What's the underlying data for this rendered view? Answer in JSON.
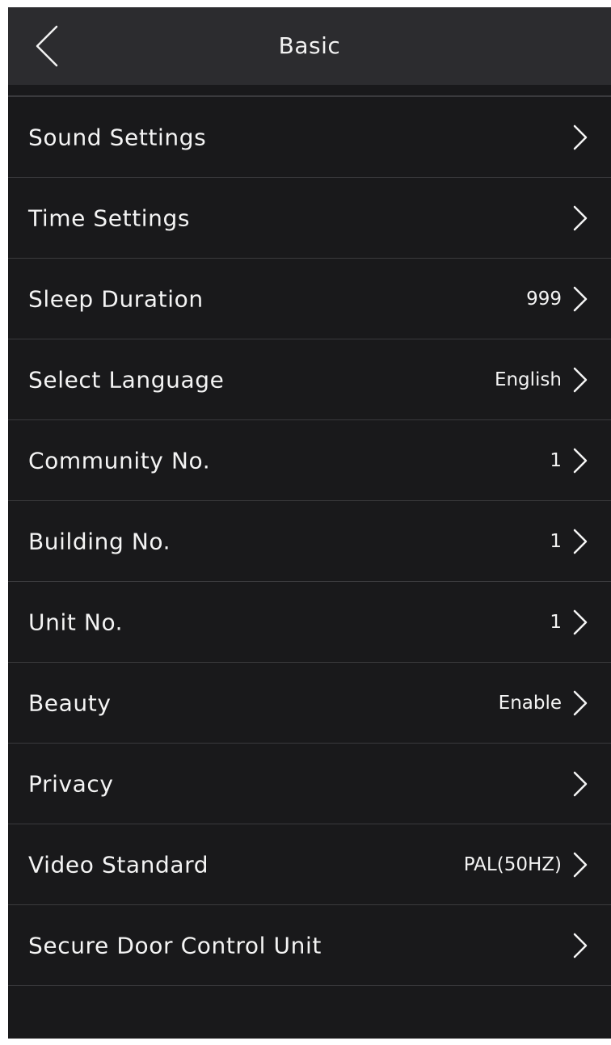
{
  "header": {
    "title": "Basic",
    "back_icon": "chevron-left-icon"
  },
  "settings": {
    "items": [
      {
        "label": "Sound Settings",
        "value": ""
      },
      {
        "label": "Time Settings",
        "value": ""
      },
      {
        "label": "Sleep Duration",
        "value": "999"
      },
      {
        "label": "Select Language",
        "value": "English"
      },
      {
        "label": "Community No.",
        "value": "1"
      },
      {
        "label": "Building No.",
        "value": "1"
      },
      {
        "label": "Unit No.",
        "value": "1"
      },
      {
        "label": "Beauty",
        "value": "Enable"
      },
      {
        "label": "Privacy",
        "value": ""
      },
      {
        "label": "Video Standard",
        "value": "PAL(50HZ)"
      },
      {
        "label": "Secure Door Control Unit",
        "value": ""
      }
    ],
    "row_icon": "chevron-right-icon"
  },
  "colors": {
    "background": "#19191b",
    "header": "#2c2c2f",
    "divider": "#3a3a3d",
    "text": "#f4f4f4"
  }
}
